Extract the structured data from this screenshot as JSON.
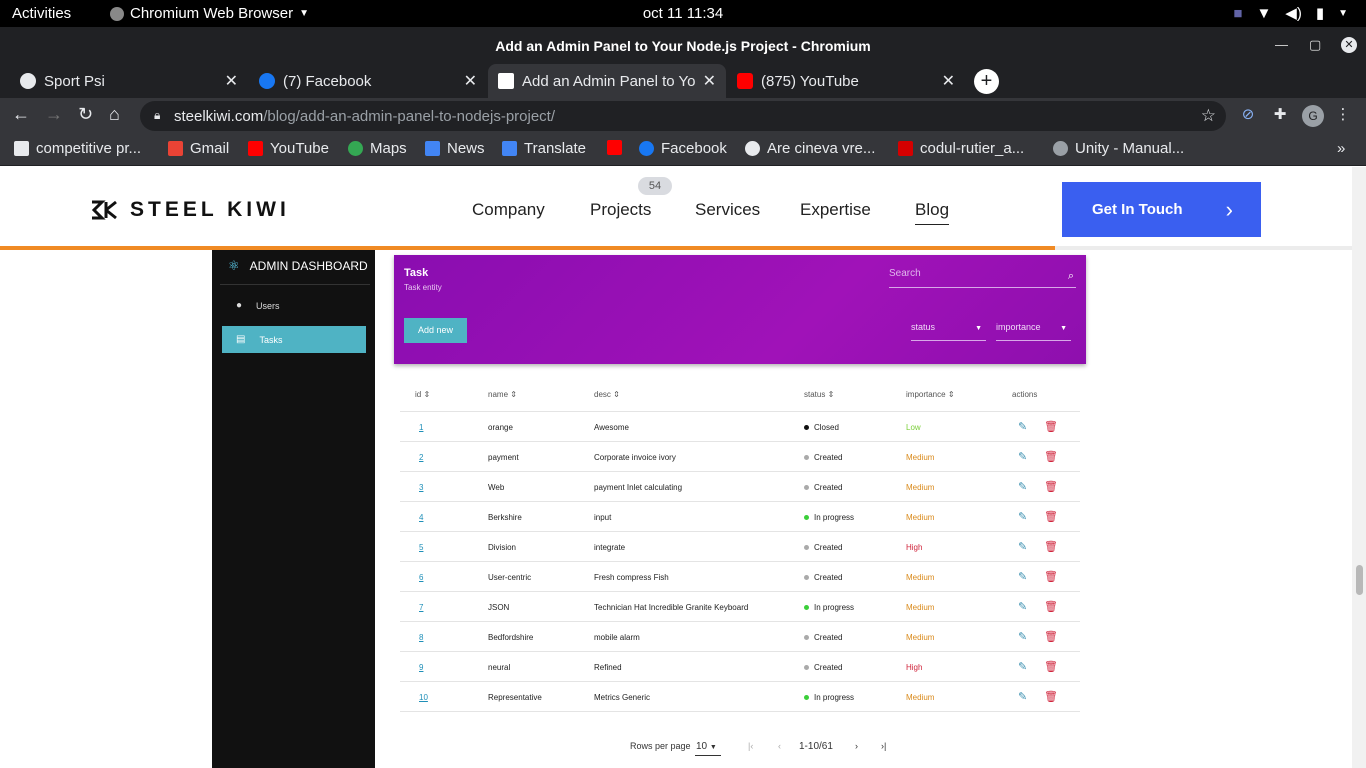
{
  "system_bar": {
    "activities": "Activities",
    "app_name": "Chromium Web Browser",
    "clock": "oct 11  11:34"
  },
  "window": {
    "title": "Add an Admin Panel to Your Node.js Project - Chromium"
  },
  "tabs": [
    {
      "label": "Sport Psi",
      "active": false,
      "color": "#e8eaed"
    },
    {
      "label": "(7) Facebook",
      "active": false,
      "color": "#1877f2"
    },
    {
      "label": "Add an Admin Panel to Yo",
      "active": true,
      "color": "#ffffff"
    },
    {
      "label": "(875) YouTube",
      "active": false,
      "color": "#ff0000"
    }
  ],
  "address_bar": {
    "domain": "steelkiwi.com",
    "path": "/blog/add-an-admin-panel-to-nodejs-project/",
    "profile_initial": "G"
  },
  "bookmarks": [
    {
      "label": "competitive pr...",
      "color": "#e8eaed"
    },
    {
      "label": "Gmail",
      "color": "#ea4335"
    },
    {
      "label": "YouTube",
      "color": "#ff0000"
    },
    {
      "label": "Maps",
      "color": "#34a853"
    },
    {
      "label": "News",
      "color": "#4285f4"
    },
    {
      "label": "Translate",
      "color": "#4285f4"
    },
    {
      "label": "",
      "color": "#ff0000"
    },
    {
      "label": "Facebook",
      "color": "#1877f2"
    },
    {
      "label": "Are cineva vre...",
      "color": "#e8eaed"
    },
    {
      "label": "codul-rutier_a...",
      "color": "#d50000"
    },
    {
      "label": "Unity - Manual...",
      "color": "#9aa0a6"
    }
  ],
  "site": {
    "logo": "STEEL KIWI",
    "nav": [
      "Company",
      "Projects",
      "Services",
      "Expertise",
      "Blog"
    ],
    "projects_badge": "54",
    "cta": "Get In Touch",
    "read_progress": 0.78,
    "accent": "#3a5ff0"
  },
  "admin": {
    "brand": "ADMIN DASHBOARD",
    "sidebar": [
      "Users",
      "Tasks"
    ],
    "banner": {
      "title": "Task",
      "subtitle": "Task entity",
      "search_placeholder": "Search",
      "add_button": "Add new",
      "filter_status": "status",
      "filter_importance": "importance"
    },
    "columns": [
      "id",
      "name",
      "desc",
      "status",
      "importance",
      "actions"
    ],
    "rows": [
      {
        "id": "1",
        "name": "orange",
        "desc": "Awesome",
        "status": "Closed",
        "status_color": "#111111",
        "importance": "Low",
        "imp_color": "#7ccf3a"
      },
      {
        "id": "2",
        "name": "payment",
        "desc": "Corporate invoice ivory",
        "status": "Created",
        "status_color": "#aaaaaa",
        "importance": "Medium",
        "imp_color": "#d98a1c"
      },
      {
        "id": "3",
        "name": "Web",
        "desc": "payment Inlet calculating",
        "status": "Created",
        "status_color": "#aaaaaa",
        "importance": "Medium",
        "imp_color": "#d98a1c"
      },
      {
        "id": "4",
        "name": "Berkshire",
        "desc": "input",
        "status": "In progress",
        "status_color": "#3ccf3a",
        "importance": "Medium",
        "imp_color": "#d98a1c"
      },
      {
        "id": "5",
        "name": "Division",
        "desc": "integrate",
        "status": "Created",
        "status_color": "#aaaaaa",
        "importance": "High",
        "imp_color": "#d0253c"
      },
      {
        "id": "6",
        "name": "User-centric",
        "desc": "Fresh compress Fish",
        "status": "Created",
        "status_color": "#aaaaaa",
        "importance": "Medium",
        "imp_color": "#d98a1c"
      },
      {
        "id": "7",
        "name": "JSON",
        "desc": "Technician Hat Incredible Granite Keyboard",
        "status": "In progress",
        "status_color": "#3ccf3a",
        "importance": "Medium",
        "imp_color": "#d98a1c"
      },
      {
        "id": "8",
        "name": "Bedfordshire",
        "desc": "mobile alarm",
        "status": "Created",
        "status_color": "#aaaaaa",
        "importance": "Medium",
        "imp_color": "#d98a1c"
      },
      {
        "id": "9",
        "name": "neural",
        "desc": "Refined",
        "status": "Created",
        "status_color": "#aaaaaa",
        "importance": "High",
        "imp_color": "#d0253c"
      },
      {
        "id": "10",
        "name": "Representative",
        "desc": "Metrics Generic",
        "status": "In progress",
        "status_color": "#3ccf3a",
        "importance": "Medium",
        "imp_color": "#d98a1c"
      }
    ],
    "pagination": {
      "rows_label": "Rows per page",
      "rows_value": "10",
      "range": "1-10/61"
    }
  }
}
